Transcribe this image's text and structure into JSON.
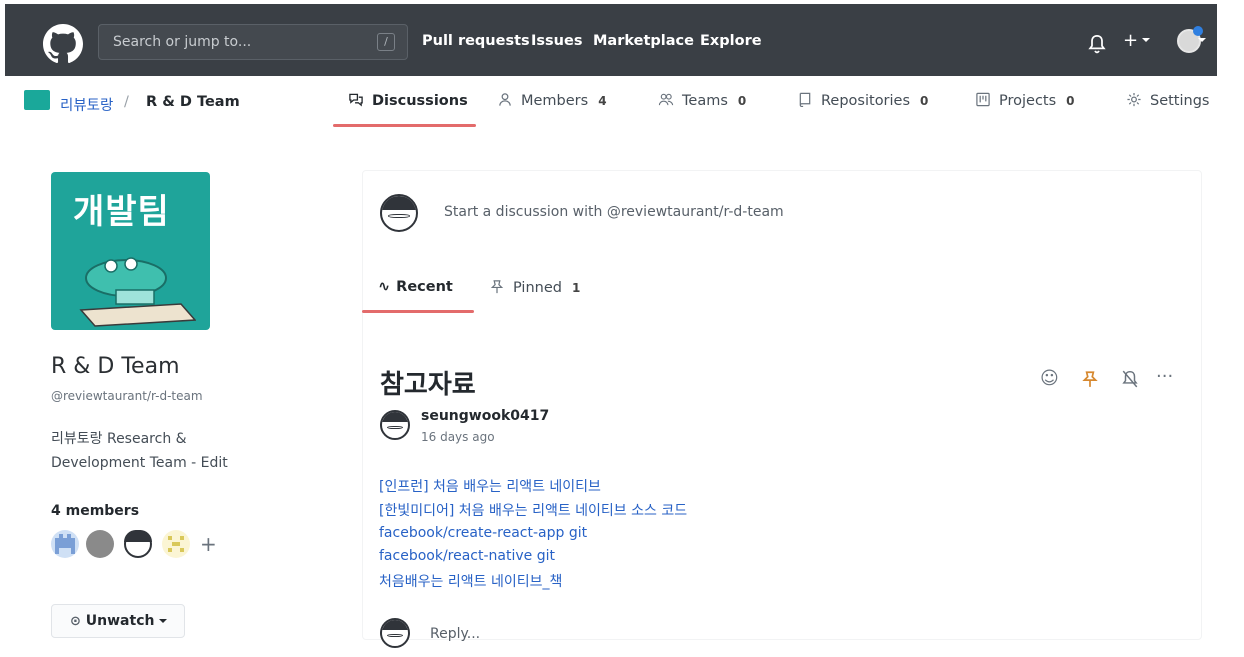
{
  "header": {
    "search_placeholder": "Search or jump to...",
    "search_shortcut": "/",
    "nav": [
      "Pull requests",
      "Issues",
      "Marketplace",
      "Explore"
    ]
  },
  "team_nav": {
    "org_name": "리뷰토랑",
    "team_name": "R & D Team",
    "tabs": [
      {
        "label": "Discussions",
        "count": ""
      },
      {
        "label": "Members",
        "count": "4"
      },
      {
        "label": "Teams",
        "count": "0"
      },
      {
        "label": "Repositories",
        "count": "0"
      },
      {
        "label": "Projects",
        "count": "0"
      },
      {
        "label": "Settings",
        "count": ""
      }
    ]
  },
  "sidebar": {
    "avatar_text": "개발팀",
    "team_name": "R & D Team",
    "handle": "@reviewtaurant/r-d-team",
    "description_line1": "리뷰토랑 Research &",
    "description_line2": "Development Team - Edit",
    "members_title": "4 members",
    "unwatch_label": "Unwatch"
  },
  "main": {
    "start_discussion": "Start a discussion with @reviewtaurant/r-d-team",
    "subtabs": [
      {
        "label": "Recent",
        "count": ""
      },
      {
        "label": "Pinned",
        "count": "1"
      }
    ],
    "post": {
      "title": "참고자료",
      "author": "seungwook0417",
      "time": "16 days ago",
      "links": [
        "[인프런] 처음 배우는 리액트 네이티브",
        "[한빛미디어] 처음 배우는 리액트 네이티브 소스 코드",
        "facebook/create-react-app git",
        "facebook/react-native git",
        "처음배우는 리액트 네이티브_책"
      ]
    },
    "reply_placeholder": "Reply..."
  },
  "colors": {
    "header_bg": "#3a3f45",
    "accent_underline": "#e36b6b",
    "link": "#2862c6",
    "team_avatar_bg": "#1fa49a"
  }
}
